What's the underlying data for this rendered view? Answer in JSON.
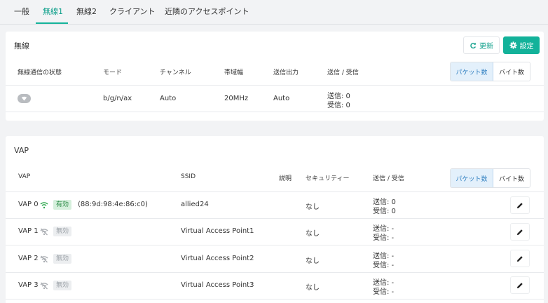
{
  "tabs": [
    {
      "label": "一般"
    },
    {
      "label": "無線1"
    },
    {
      "label": "無線2"
    },
    {
      "label": "クライアント"
    },
    {
      "label": "近隣のアクセスポイント"
    }
  ],
  "wireless": {
    "title": "無線",
    "refresh_label": "更新",
    "settings_label": "設定",
    "headers": {
      "status": "無線通信の状態",
      "mode": "モード",
      "channel": "チャンネル",
      "bandwidth": "帯域幅",
      "tx_power": "送信出力",
      "tx_rx": "送信 / 受信"
    },
    "toggle": {
      "packets": "パケット数",
      "bytes": "バイト数"
    },
    "row": {
      "mode": "b/g/n/ax",
      "channel": "Auto",
      "bandwidth": "20MHz",
      "tx_power": "Auto",
      "tx": "送信: 0",
      "rx": "受信: 0"
    }
  },
  "vap": {
    "title": "VAP",
    "headers": {
      "vap": "VAP",
      "ssid": "SSID",
      "description": "説明",
      "security": "セキュリティー",
      "tx_rx": "送信 / 受信"
    },
    "toggle": {
      "packets": "パケット数",
      "bytes": "バイト数"
    },
    "rows": [
      {
        "name": "VAP 0",
        "status": "有効",
        "mac": "(88:9d:98:4e:86:c0)",
        "ssid": "allied24",
        "security": "なし",
        "tx": "送信: 0",
        "rx": "受信: 0"
      },
      {
        "name": "VAP 1",
        "status": "無効",
        "mac": "",
        "ssid": "Virtual Access Point1",
        "security": "なし",
        "tx": "送信: -",
        "rx": "受信: -"
      },
      {
        "name": "VAP 2",
        "status": "無効",
        "mac": "",
        "ssid": "Virtual Access Point2",
        "security": "なし",
        "tx": "送信: -",
        "rx": "受信: -"
      },
      {
        "name": "VAP 3",
        "status": "無効",
        "mac": "",
        "ssid": "Virtual Access Point3",
        "security": "なし",
        "tx": "送信: -",
        "rx": "受信: -"
      }
    ]
  },
  "colors": {
    "accent": "#13b29a",
    "enabled": "#2a8a45",
    "toggle_active": "#2f7fc1"
  }
}
